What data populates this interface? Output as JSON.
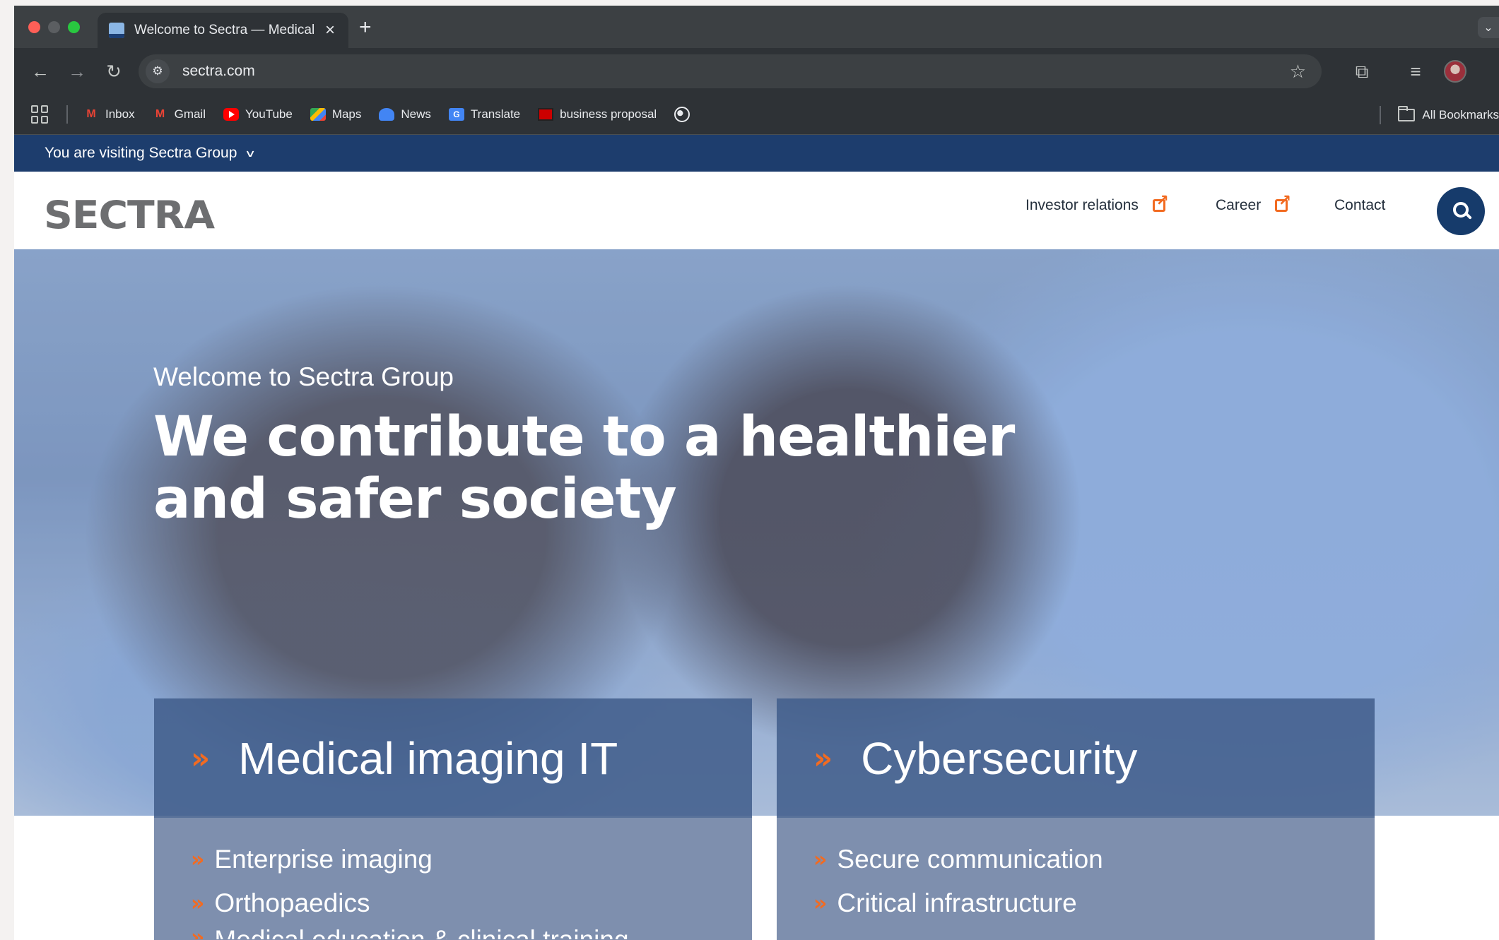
{
  "browser": {
    "tab_title": "Welcome to Sectra — Medical",
    "url": "sectra.com",
    "bookmarks": [
      {
        "label": "Inbox",
        "icon": "gmail-icon"
      },
      {
        "label": "Gmail",
        "icon": "gmail-icon"
      },
      {
        "label": "YouTube",
        "icon": "youtube-icon"
      },
      {
        "label": "Maps",
        "icon": "maps-icon"
      },
      {
        "label": "News",
        "icon": "news-icon"
      },
      {
        "label": "Translate",
        "icon": "translate-icon"
      },
      {
        "label": "business proposal",
        "icon": "business-proposal-icon"
      }
    ],
    "all_bookmarks_label": "All Bookmarks"
  },
  "site": {
    "visit_bar_label": "You are visiting Sectra Group",
    "logo_text": "SECTRA",
    "nav": {
      "investor_relations": "Investor relations",
      "career": "Career",
      "contact": "Contact"
    },
    "hero": {
      "kicker": "Welcome to Sectra Group",
      "title": "We contribute to a healthier and safer society"
    },
    "cards": [
      {
        "title": "Medical imaging IT",
        "items": [
          "Enterprise imaging",
          "Orthopaedics",
          "Medical education & clinical training"
        ]
      },
      {
        "title": "Cybersecurity",
        "items": [
          "Secure communication",
          "Critical infrastructure"
        ]
      }
    ]
  },
  "colors": {
    "header_blue": "#1d3d6d",
    "accent_orange": "#f26b21",
    "search_button": "#163b6b"
  }
}
